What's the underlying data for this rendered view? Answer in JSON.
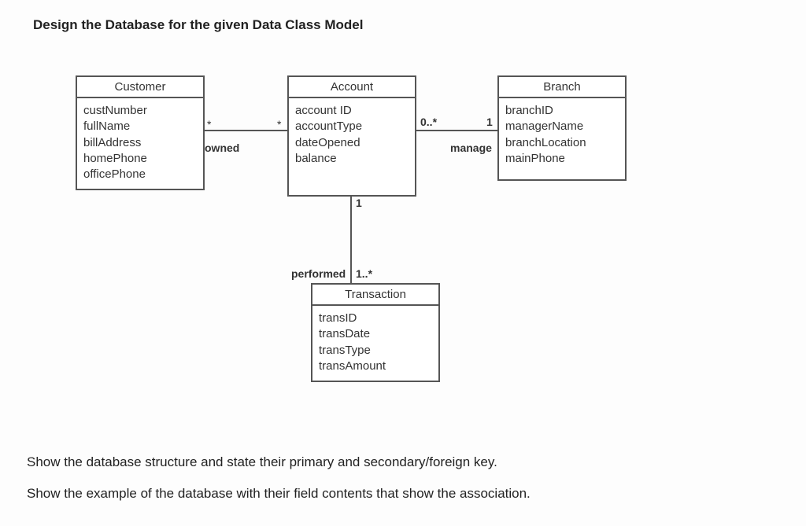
{
  "heading": "Design the Database for the given Data Class Model",
  "footer1": "Show the database structure and state their primary and secondary/foreign key.",
  "footer2": "Show the example of the database with their field contents that show the association.",
  "classes": {
    "customer": {
      "title": "Customer",
      "attrs": [
        "custNumber",
        "fullName",
        "billAddress",
        "homePhone",
        "officePhone"
      ]
    },
    "account": {
      "title": "Account",
      "attrs": [
        "account ID",
        "accountType",
        "dateOpened",
        "balance"
      ]
    },
    "branch": {
      "title": "Branch",
      "attrs": [
        "branchID",
        "managerName",
        "branchLocation",
        "mainPhone"
      ]
    },
    "transaction": {
      "title": "Transaction",
      "attrs": [
        "transID",
        "transDate",
        "transType",
        "transAmount"
      ]
    }
  },
  "labels": {
    "owned": "owned",
    "manage": "manage",
    "performed": "performed",
    "star1": "*",
    "star2": "*",
    "zero_star": "0..*",
    "one_a": "1",
    "one_b": "1",
    "one_star": "1..*"
  },
  "chart_data": {
    "type": "uml-class-diagram",
    "classes": [
      {
        "name": "Customer",
        "attributes": [
          "custNumber",
          "fullName",
          "billAddress",
          "homePhone",
          "officePhone"
        ]
      },
      {
        "name": "Account",
        "attributes": [
          "account ID",
          "accountType",
          "dateOpened",
          "balance"
        ]
      },
      {
        "name": "Branch",
        "attributes": [
          "branchID",
          "managerName",
          "branchLocation",
          "mainPhone"
        ]
      },
      {
        "name": "Transaction",
        "attributes": [
          "transID",
          "transDate",
          "transType",
          "transAmount"
        ]
      }
    ],
    "associations": [
      {
        "from": "Customer",
        "to": "Account",
        "label": "owned",
        "from_mult": "*",
        "to_mult": "*"
      },
      {
        "from": "Account",
        "to": "Branch",
        "label": "manage",
        "from_mult": "0..*",
        "to_mult": "1"
      },
      {
        "from": "Account",
        "to": "Transaction",
        "label": "performed",
        "from_mult": "1",
        "to_mult": "1..*"
      }
    ]
  }
}
